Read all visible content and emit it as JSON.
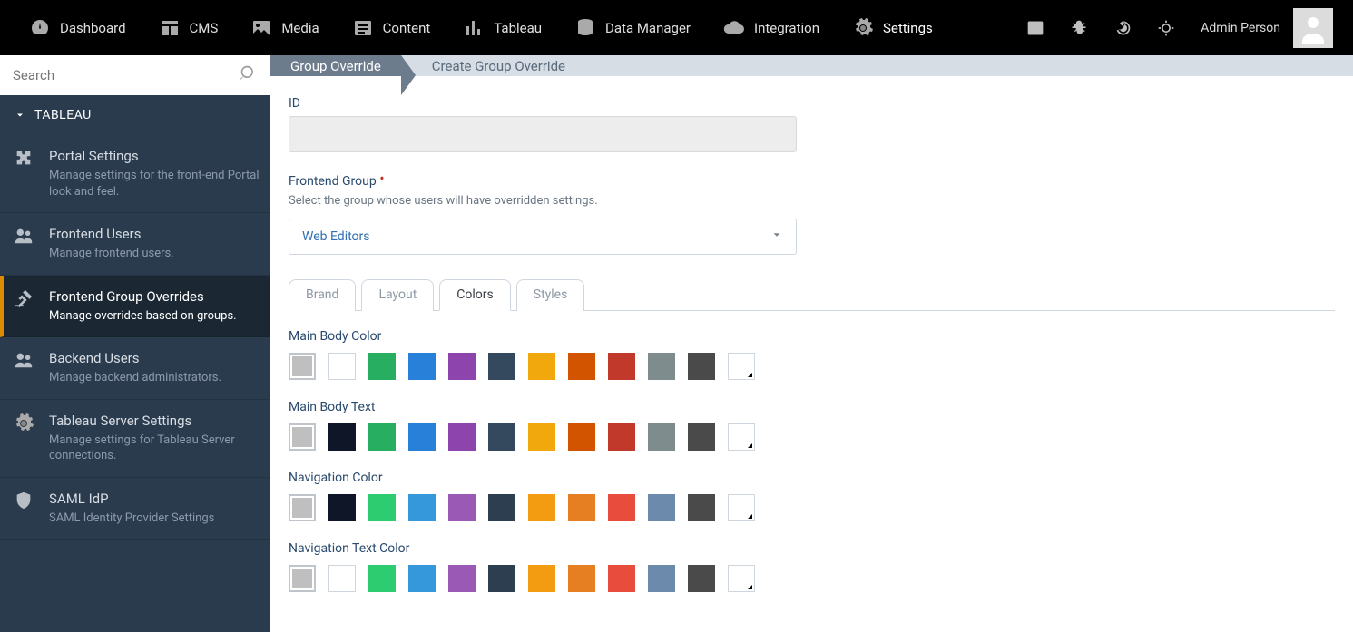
{
  "topnav": {
    "items": [
      {
        "label": "Dashboard",
        "icon": "gauge"
      },
      {
        "label": "CMS",
        "icon": "cms"
      },
      {
        "label": "Media",
        "icon": "image"
      },
      {
        "label": "Content",
        "icon": "list"
      },
      {
        "label": "Tableau",
        "icon": "chart"
      },
      {
        "label": "Data Manager",
        "icon": "database"
      },
      {
        "label": "Integration",
        "icon": "cloud"
      },
      {
        "label": "Settings",
        "icon": "gear",
        "active": true
      }
    ],
    "user_name": "Admin Person"
  },
  "search": {
    "placeholder": "Search"
  },
  "sidebar": {
    "section": "TABLEAU",
    "items": [
      {
        "title": "Portal Settings",
        "desc": "Manage settings for the front-end Portal look and feel.",
        "icon": "puzzle"
      },
      {
        "title": "Frontend Users",
        "desc": "Manage frontend users.",
        "icon": "users"
      },
      {
        "title": "Frontend Group Overrides",
        "desc": "Manage overrides based on groups.",
        "icon": "gavel",
        "active": true
      },
      {
        "title": "Backend Users",
        "desc": "Manage backend administrators.",
        "icon": "users"
      },
      {
        "title": "Tableau Server Settings",
        "desc": "Manage settings for Tableau Server connections.",
        "icon": "gear"
      },
      {
        "title": "SAML IdP",
        "desc": "SAML Identity Provider Settings",
        "icon": "shield"
      }
    ]
  },
  "breadcrumb": {
    "first": "Group Override",
    "second": "Create Group Override"
  },
  "form": {
    "id_label": "ID",
    "group_label": "Frontend Group",
    "group_help": "Select the group whose users will have overridden settings.",
    "group_value": "Web Editors"
  },
  "tabs": [
    "Brand",
    "Layout",
    "Colors",
    "Styles"
  ],
  "active_tab": "Colors",
  "color_sections": [
    {
      "label": "Main Body Color",
      "selected_bg": "#bfbfbf",
      "colors": [
        "#ffffff",
        "#27ae60",
        "#2980d9",
        "#8e44ad",
        "#34495e",
        "#f1a80c",
        "#d35400",
        "#c0392b",
        "#7f8c8d",
        "#4a4a4a"
      ],
      "white_border": [
        0
      ]
    },
    {
      "label": "Main Body Text",
      "selected_bg": "#bfbfbf",
      "colors": [
        "#0f1628",
        "#27ae60",
        "#2980d9",
        "#8e44ad",
        "#34495e",
        "#f1a80c",
        "#d35400",
        "#c0392b",
        "#7f8c8d",
        "#4a4a4a"
      ]
    },
    {
      "label": "Navigation Color",
      "selected_bg": "#bfbfbf",
      "colors": [
        "#0f1628",
        "#2ecc71",
        "#3498db",
        "#9b59b6",
        "#2c3e50",
        "#f39c12",
        "#e67e22",
        "#e74c3c",
        "#6b8aac",
        "#4a4a4a"
      ]
    },
    {
      "label": "Navigation Text Color",
      "selected_bg": "#bfbfbf",
      "colors": [
        "#ffffff",
        "#2ecc71",
        "#3498db",
        "#9b59b6",
        "#2c3e50",
        "#f39c12",
        "#e67e22",
        "#e74c3c",
        "#6b8aac",
        "#4a4a4a"
      ],
      "white_border": [
        0
      ]
    }
  ]
}
